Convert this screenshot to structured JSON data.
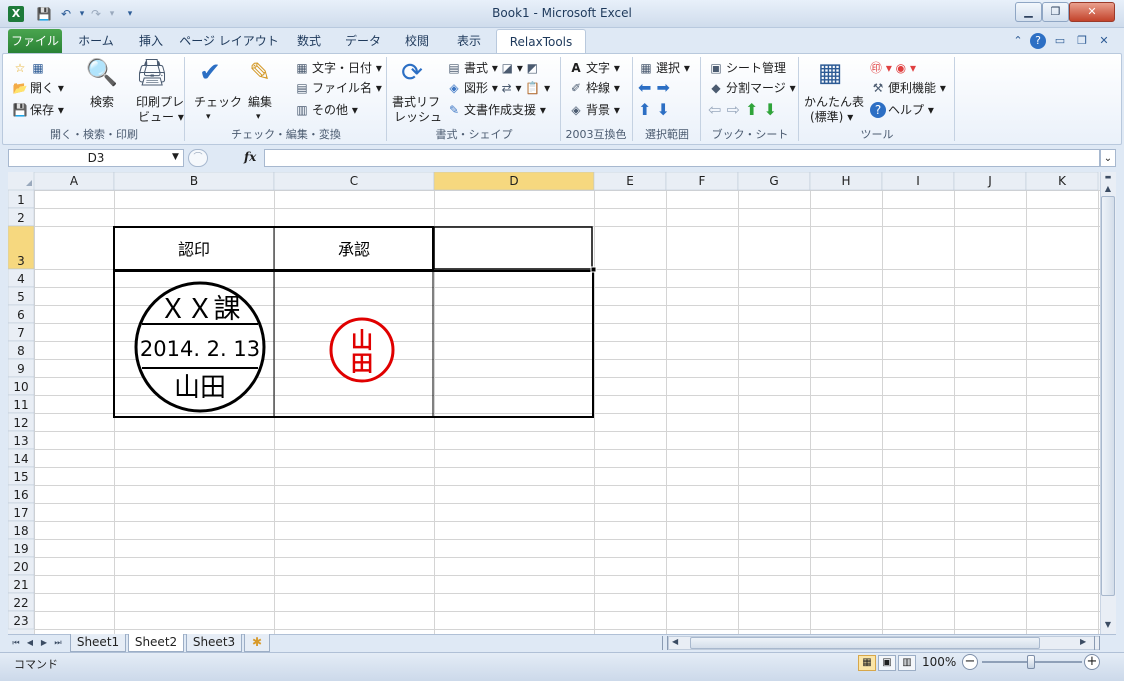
{
  "window": {
    "title": "Book1 - Microsoft Excel",
    "app_icon": "X",
    "min": "▁",
    "max": "❐",
    "close": "✕"
  },
  "qat": {
    "save": "💾",
    "undo": "↶",
    "redo": "↷",
    "more": "▾"
  },
  "tabs": [
    "ファイル",
    "ホーム",
    "挿入",
    "ページ レイアウト",
    "数式",
    "データ",
    "校閲",
    "表示",
    "RelaxTools"
  ],
  "ribbon": {
    "g1": {
      "new_label": "☆",
      "open": "開く",
      "save": "保存",
      "search": "検索",
      "preview_l1": "印刷プレ",
      "preview_l2": "ビュー",
      "label": "開く・検索・印刷"
    },
    "g2": {
      "check": "チェック",
      "edit": "編集",
      "textdate": "文字・日付",
      "filename": "ファイル名",
      "other": "その他",
      "label": "チェック・編集・変換"
    },
    "g3": {
      "refresh_l1": "書式リフ",
      "refresh_l2": "レッシュ",
      "format": "書式",
      "shape": "図形",
      "docsupport": "文書作成支援",
      "label": "書式・シェイプ"
    },
    "g4": {
      "text": "文字",
      "border": "枠線",
      "bg": "背景",
      "label": "2003互換色"
    },
    "g5": {
      "select": "選択",
      "label": "選択範囲"
    },
    "g6": {
      "sheetmgr": "シート管理",
      "splitmerge": "分割マージ",
      "label": "ブック・シート"
    },
    "g7": {
      "easytable_l1": "かんたん表",
      "easytable_l2": "(標準)",
      "useful": "便利機能",
      "help": "ヘルプ",
      "label": "ツール"
    }
  },
  "formula_bar": {
    "namebox": "D3",
    "fx": "fx",
    "value": ""
  },
  "columns": [
    "A",
    "B",
    "C",
    "D",
    "E",
    "F",
    "G",
    "H",
    "I",
    "J",
    "K"
  ],
  "rows": [
    "1",
    "2",
    "3",
    "4",
    "5",
    "6",
    "7",
    "8",
    "9",
    "10",
    "11",
    "12",
    "13",
    "14",
    "15",
    "16",
    "17",
    "18",
    "19",
    "20",
    "21",
    "22",
    "23"
  ],
  "table": {
    "header_b": "認印",
    "header_c": "承認"
  },
  "stamp_dated": {
    "top": "ＸＸ課",
    "middle": "2014. 2. 13",
    "bottom": "山田"
  },
  "stamp_red": {
    "text": "山田",
    "color": "#e00000"
  },
  "sheets": [
    "Sheet1",
    "Sheet2",
    "Sheet3"
  ],
  "active_sheet": "Sheet2",
  "status": {
    "mode": "コマンド",
    "zoom": "100%"
  },
  "colors": {
    "selected_header": "#f6d87f",
    "gridline": "#d4d4d4",
    "header_bg": "#e9eef5"
  }
}
